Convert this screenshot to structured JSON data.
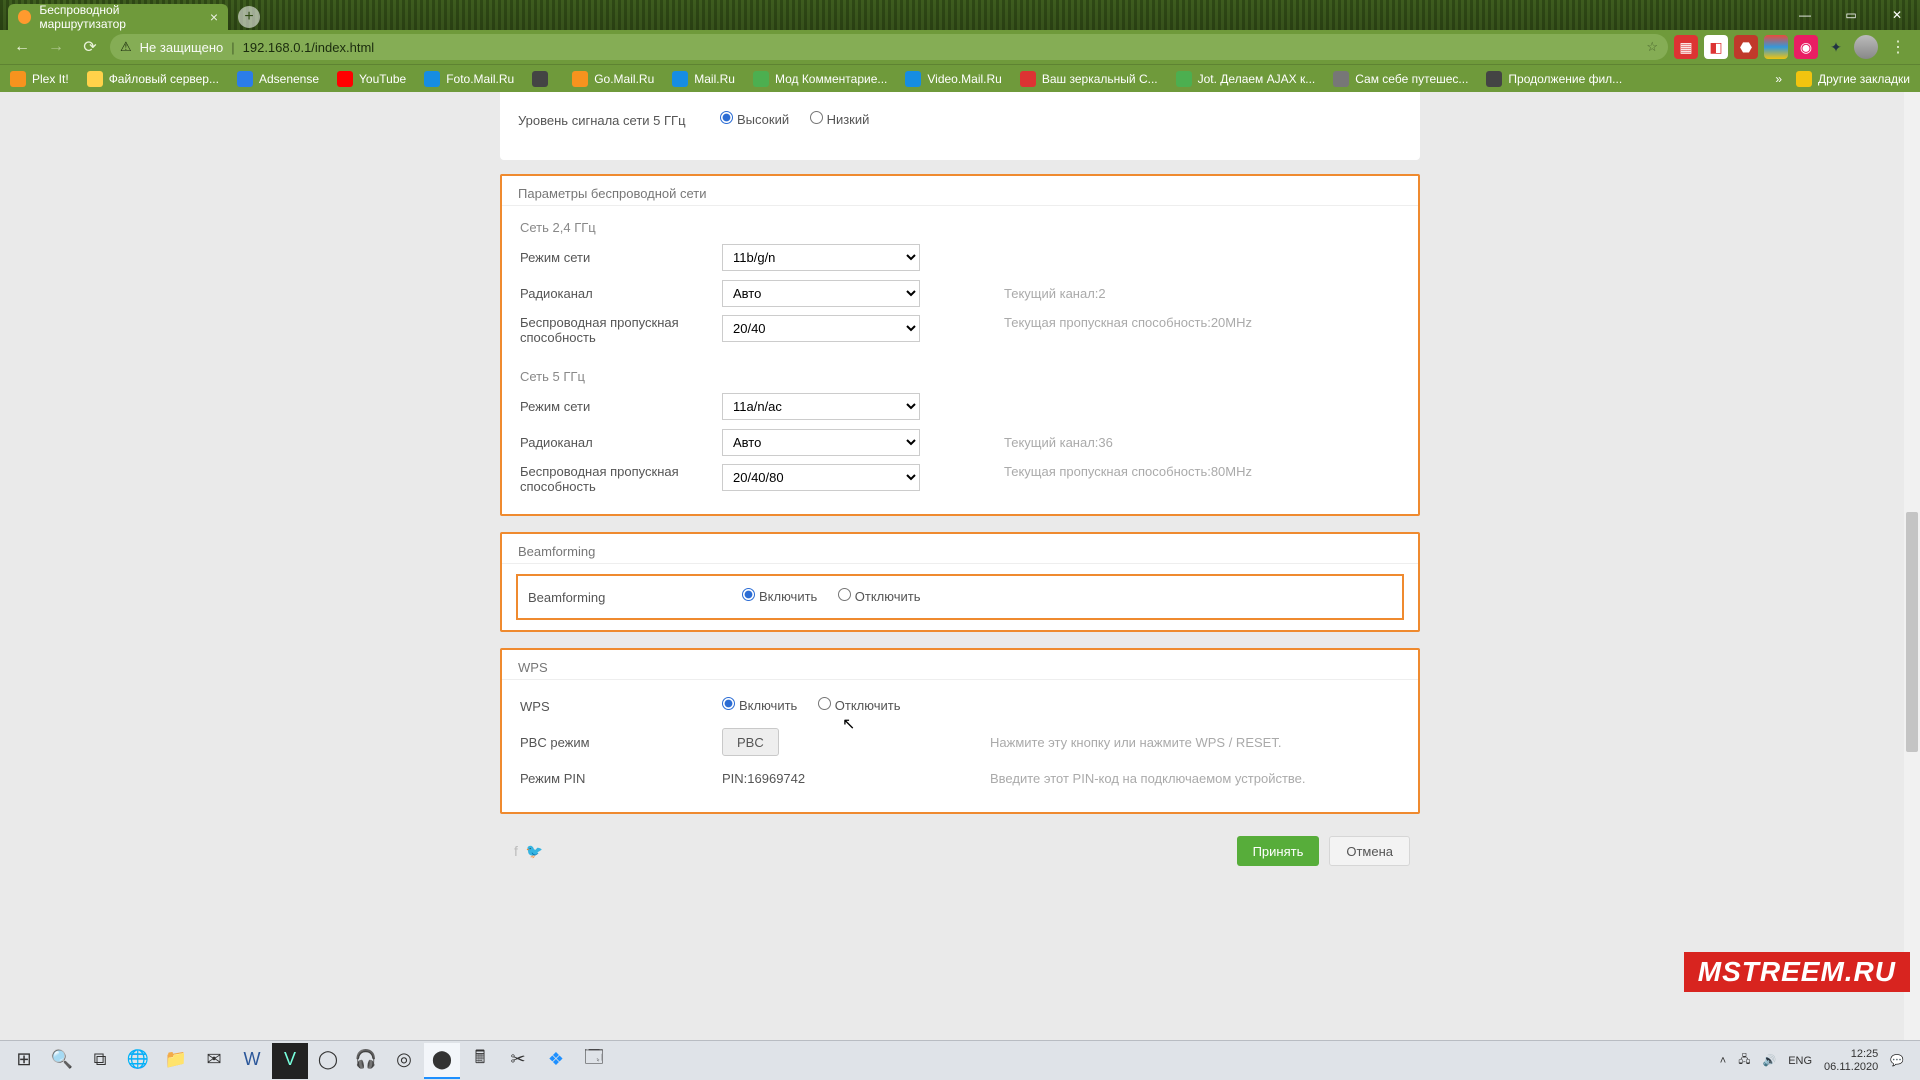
{
  "browser": {
    "tab_title": "Беспроводной маршрутизатор",
    "insecure_label": "Не защищено",
    "url": "192.168.0.1/index.html",
    "window": {
      "min": "—",
      "max": "▭",
      "close": "✕"
    },
    "newtab": "+"
  },
  "bookmarks": {
    "items": [
      {
        "label": "Plex It!",
        "color": "#f7931e"
      },
      {
        "label": "Файловый сервер...",
        "color": "#ffd24a"
      },
      {
        "label": "Adsenense",
        "color": "#2b7de9"
      },
      {
        "label": "YouTube",
        "color": "#ff0000"
      },
      {
        "label": "Foto.Mail.Ru",
        "color": "#168de2"
      },
      {
        "label": "",
        "color": "#444"
      },
      {
        "label": "Go.Mail.Ru",
        "color": "#f7931e"
      },
      {
        "label": "Mail.Ru",
        "color": "#168de2"
      },
      {
        "label": "Мод Комментарие...",
        "color": "#4caf50"
      },
      {
        "label": "Video.Mail.Ru",
        "color": "#168de2"
      },
      {
        "label": "Ваш зеркальный C...",
        "color": "#d33"
      },
      {
        "label": "Jot. Делаем AJAX к...",
        "color": "#4caf50"
      },
      {
        "label": "Сам себе путешес...",
        "color": "#777"
      },
      {
        "label": "Продолжение фил...",
        "color": "#444"
      }
    ],
    "overflow": "»",
    "other": "Другие закладки"
  },
  "page": {
    "signal5_label": "Уровень сигнала сети 5 ГГц",
    "signal_high": "Высокий",
    "signal_low": "Низкий",
    "wireless_params_title": "Параметры беспроводной сети",
    "net24_title": "Сеть 2,4 ГГц",
    "net5_title": "Сеть 5 ГГц",
    "mode_label": "Режим сети",
    "mode24_value": "11b/g/n",
    "mode5_value": "11a/n/ac",
    "channel_label": "Радиоканал",
    "channel_value": "Авто",
    "channel24_current": "Текущий канал:2",
    "channel5_current": "Текущий канал:36",
    "bw_label": "Беспроводная пропускная способность",
    "bw24_value": "20/40",
    "bw5_value": "20/40/80",
    "bw24_current": "Текущая пропускная способность:20MHz",
    "bw5_current": "Текущая пропускная способность:80MHz",
    "beamforming_title": "Beamforming",
    "beamforming_label": "Beamforming",
    "on": "Включить",
    "off": "Отключить",
    "wps_title": "WPS",
    "wps_label": "WPS",
    "pbc_label": "PBC режим",
    "pbc_btn": "PBC",
    "pbc_hint": "Нажмите эту кнопку или нажмите WPS / RESET.",
    "pin_label": "Режим PIN",
    "pin_value": "PIN:16969742",
    "pin_hint": "Введите этот PIN-код на подключаемом устройстве.",
    "ok": "Принять",
    "cancel": "Отмена"
  },
  "watermark": "MSTREEM.RU",
  "tray": {
    "lang": "ENG",
    "time": "12:25",
    "date": "06.11.2020"
  }
}
